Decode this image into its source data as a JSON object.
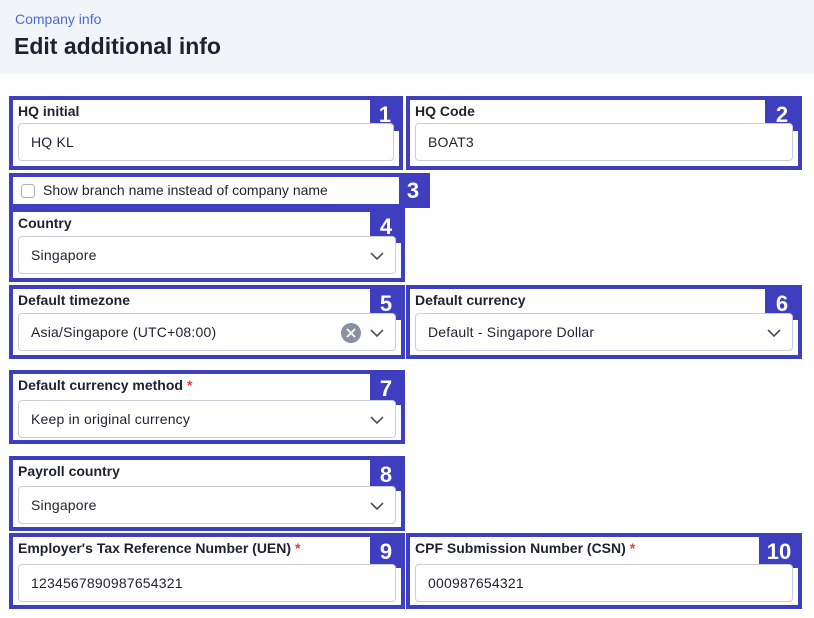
{
  "header": {
    "breadcrumb": "Company info",
    "title": "Edit additional info"
  },
  "hq_initial": {
    "badge": "1",
    "label": "HQ initial",
    "value": "HQ KL"
  },
  "hq_code": {
    "badge": "2",
    "label": "HQ Code",
    "value": "BOAT3"
  },
  "branch_name": {
    "badge": "3",
    "label": "Show branch name instead of company name",
    "checked": false
  },
  "country": {
    "badge": "4",
    "label": "Country",
    "value": "Singapore"
  },
  "timezone": {
    "badge": "5",
    "label": "Default timezone",
    "value": "Asia/Singapore (UTC+08:00)"
  },
  "currency": {
    "badge": "6",
    "label": "Default currency",
    "value": "Default - Singapore Dollar"
  },
  "currency_method": {
    "badge": "7",
    "label": "Default currency method",
    "required": "*",
    "value": "Keep in original currency"
  },
  "payroll_country": {
    "badge": "8",
    "label": "Payroll country",
    "value": "Singapore"
  },
  "uen": {
    "badge": "9",
    "label": "Employer's Tax Reference Number (UEN)",
    "required": "*",
    "value": "1234567890987654321"
  },
  "csn": {
    "badge": "10",
    "label": "CPF Submission Number (CSN)",
    "required": "*",
    "value": "000987654321"
  },
  "colors": {
    "highlight": "#3d3fbf",
    "accent": "#4a6ad8",
    "required": "#e0403a"
  }
}
